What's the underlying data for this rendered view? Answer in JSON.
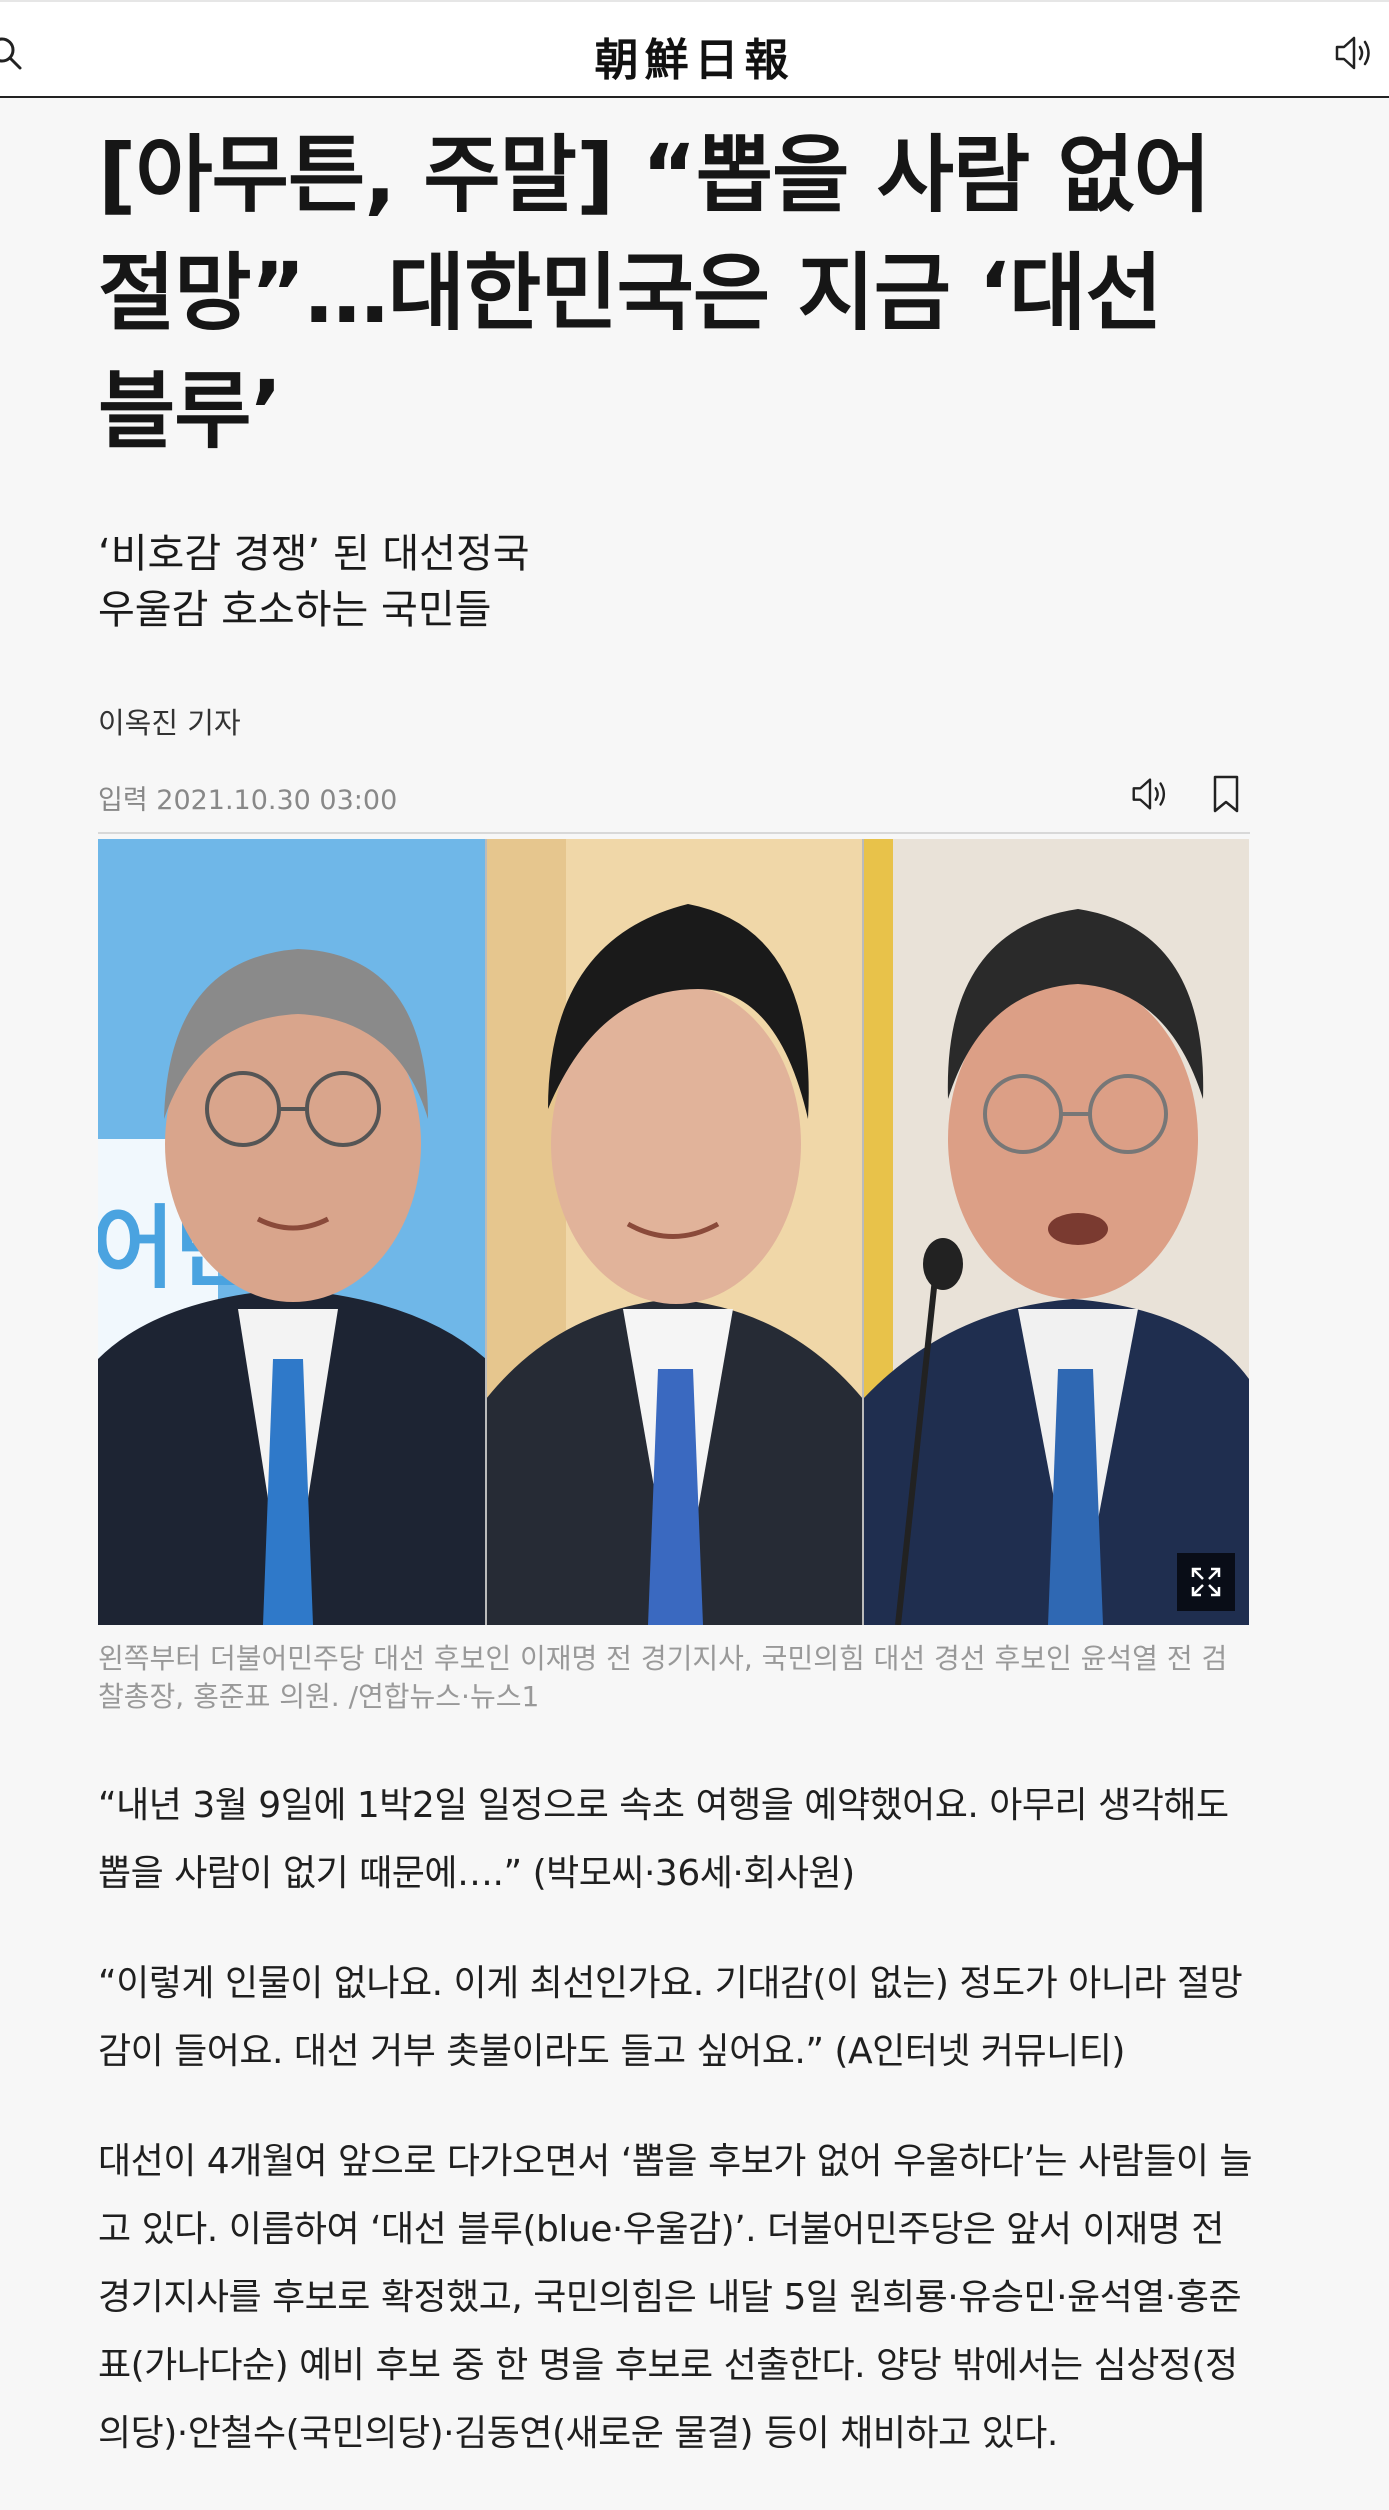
{
  "header": {
    "logo_text": "朝鮮日報",
    "search_icon": "search-icon",
    "audio_icon": "speaker-icon"
  },
  "article": {
    "headline_lines": [
      "[아무튼, 주말] “뽑을 사람 없어",
      "절망”…대한민국은 지금 ‘대선",
      "블루’"
    ],
    "subheads": [
      "‘비호감 경쟁’ 된 대선정국",
      "우울감 호소하는 국민들"
    ],
    "byline": "이옥진 기자",
    "date": "입력 2021.10.30 03:00",
    "meta_icons": [
      "speaker-icon",
      "bookmark-icon"
    ],
    "photo": {
      "expand_icon": "expand-icon",
      "backdrop_text": "어민"
    },
    "caption": "왼쪽부터 더불어민주당 대선 후보인 이재명 전 경기지사, 국민의힘 대선 경선 후보인 윤석열 전 검찰총장, 홍준표 의원. /연합뉴스·뉴스1",
    "paragraphs": [
      "“내년 3월 9일에 1박2일 일정으로 속초 여행을 예약했어요. 아무리 생각해도 뽑을 사람이 없기 때문에….” (박모씨·36세·회사원)",
      "“이렇게 인물이 없나요. 이게 최선인가요. 기대감(이 없는) 정도가 아니라 절망감이 들어요. 대선 거부 촛불이라도 들고 싶어요.” (A인터넷 커뮤니티)",
      "대선이 4개월여 앞으로 다가오면서 ‘뽑을 후보가 없어 우울하다’는 사람들이 늘고 있다. 이름하여 ‘대선 블루(blue·우울감)’. 더불어민주당은 앞서 이재명 전 경기지사를 후보로 확정했고, 국민의힘은 내달 5일 원희룡·유승민·윤석열·홍준표(가나다순) 예비 후보 중 한 명을 후보로 선출한다. 양당 밖에서는 심상정(정의당)·안철수(국민의당)·김동연(새로운 물결) 등이 채비하고 있다."
    ]
  },
  "colors": {
    "page_bg": "#f7f7f7",
    "text": "#1a1a1a",
    "muted": "#888888",
    "caption": "#999999"
  }
}
